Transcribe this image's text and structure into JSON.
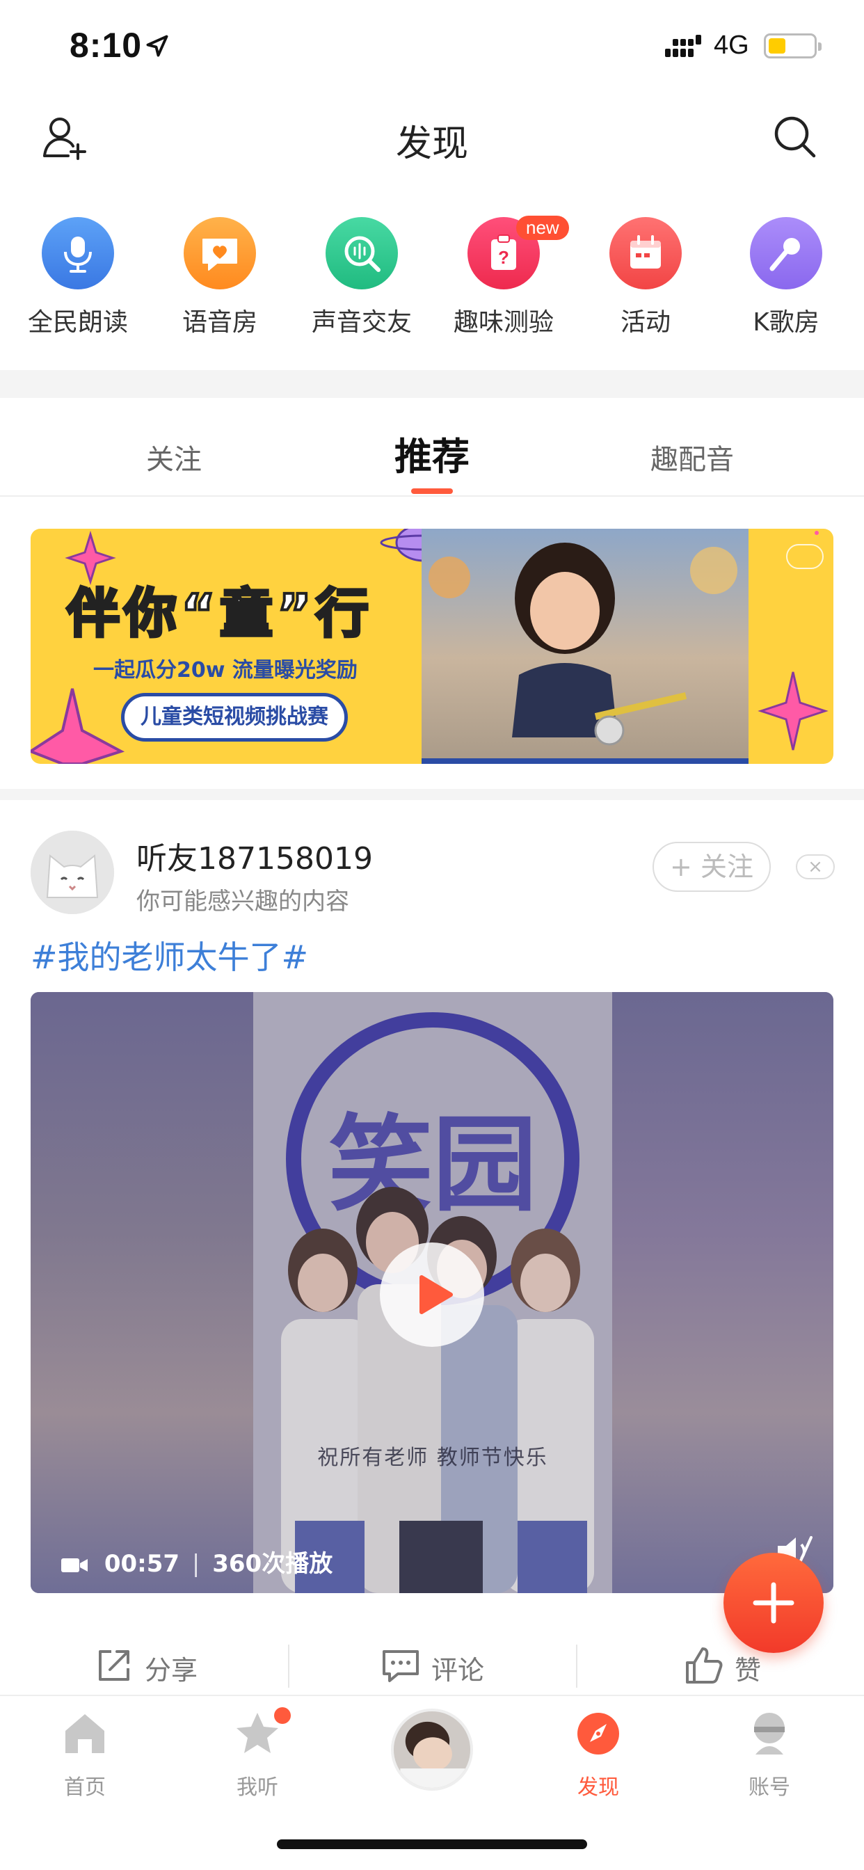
{
  "status_bar": {
    "time": "8:10",
    "network": "4G"
  },
  "nav": {
    "title": "发现"
  },
  "shortcuts": [
    {
      "label": "全民朗读",
      "icon": "microphone-icon",
      "color": "#4a8ff0"
    },
    {
      "label": "语音房",
      "icon": "heart-chat-icon",
      "color": "#ff9d2e"
    },
    {
      "label": "声音交友",
      "icon": "voice-search-icon",
      "color": "#2ec98e"
    },
    {
      "label": "趣味测验",
      "icon": "quiz-icon",
      "color": "#f5385a",
      "badge": "new"
    },
    {
      "label": "活动",
      "icon": "calendar-icon",
      "color": "#ff5a5a"
    },
    {
      "label": "K歌房",
      "icon": "karaoke-mic-icon",
      "color": "#9b7cf5"
    }
  ],
  "tabs": [
    {
      "label": "关注",
      "active": false
    },
    {
      "label": "推荐",
      "active": true
    },
    {
      "label": "趣配音",
      "active": false
    }
  ],
  "banner": {
    "title": "伴你“童”行",
    "subtitle": "一起瓜分20w 流量曝光奖励",
    "pill": "儿童类短视频挑战赛"
  },
  "card": {
    "username": "听友187158019",
    "reason": "你可能感兴趣的内容",
    "follow_label": "+ 关注",
    "dismiss_label": "×",
    "topic": "#我的老师太牛了#",
    "video": {
      "subtitle": "祝所有老师 教师节快乐",
      "duration": "00:57",
      "plays": "360次播放",
      "separator": "|"
    },
    "actions": {
      "share": "分享",
      "comment": "评论",
      "like": "赞"
    }
  },
  "tabbar": [
    {
      "label": "首页",
      "icon": "home-icon",
      "active": false
    },
    {
      "label": "我听",
      "icon": "star-icon",
      "active": false,
      "dot": true
    },
    {
      "label": "",
      "icon": "now-playing-avatar",
      "active": false
    },
    {
      "label": "发现",
      "icon": "compass-icon",
      "active": true
    },
    {
      "label": "账号",
      "icon": "user-icon",
      "active": false
    }
  ],
  "colors": {
    "accent": "#ff5a3c",
    "link": "#3d7fd8",
    "banner_bg": "#ffd23f"
  }
}
